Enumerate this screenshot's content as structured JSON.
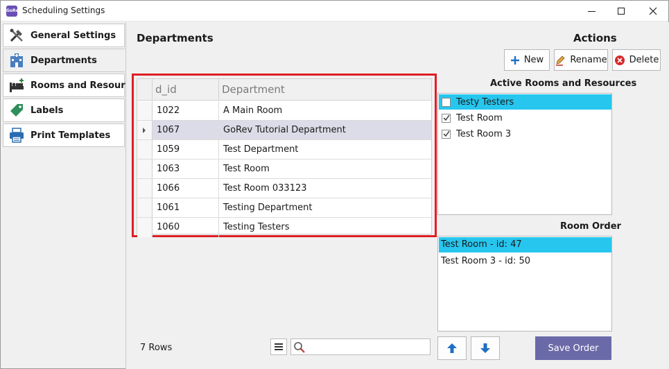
{
  "window": {
    "title": "Scheduling Settings",
    "app_icon_text": "GoRev"
  },
  "sidebar": {
    "items": [
      {
        "label": "General Settings",
        "icon": "tools-icon"
      },
      {
        "label": "Departments",
        "icon": "hospital-icon"
      },
      {
        "label": "Rooms and Resources",
        "icon": "bed-icon"
      },
      {
        "label": "Labels",
        "icon": "tag-icon"
      },
      {
        "label": "Print Templates",
        "icon": "printer-icon"
      }
    ],
    "active_index": 1
  },
  "departments": {
    "heading": "Departments",
    "columns": [
      "d_id",
      "Department"
    ],
    "rows": [
      {
        "id": "1022",
        "name": "A Main Room"
      },
      {
        "id": "1067",
        "name": "GoRev Tutorial Department"
      },
      {
        "id": "1059",
        "name": "Test Department"
      },
      {
        "id": "1063",
        "name": "Test Room"
      },
      {
        "id": "1066",
        "name": "Test Room 033123"
      },
      {
        "id": "1061",
        "name": "Testing Department"
      },
      {
        "id": "1060",
        "name": "Testing Testers"
      }
    ],
    "selected_row": 1,
    "row_count_label": "7 Rows",
    "search_value": ""
  },
  "actions": {
    "heading": "Actions",
    "new_label": "New",
    "rename_label": "Rename",
    "delete_label": "Delete"
  },
  "active_rooms": {
    "heading": "Active Rooms and Resources",
    "items": [
      {
        "label": "Testy Testers",
        "checked": false,
        "highlighted": true
      },
      {
        "label": "Test Room",
        "checked": true,
        "highlighted": false
      },
      {
        "label": "Test Room 3",
        "checked": true,
        "highlighted": false
      }
    ]
  },
  "room_order": {
    "heading": "Room Order",
    "items": [
      {
        "label": "Test Room - id: 47",
        "highlighted": true
      },
      {
        "label": "Test Room 3 - id: 50",
        "highlighted": false
      }
    ],
    "save_label": "Save Order"
  },
  "colors": {
    "highlight": "#26c6ee",
    "selected_row": "#dcdce8",
    "frame_red": "#e01e24",
    "save_button": "#6b6aa8",
    "arrow_blue": "#1e6fc4",
    "new_icon": "#1e6fc4",
    "delete_icon": "#d62828"
  }
}
